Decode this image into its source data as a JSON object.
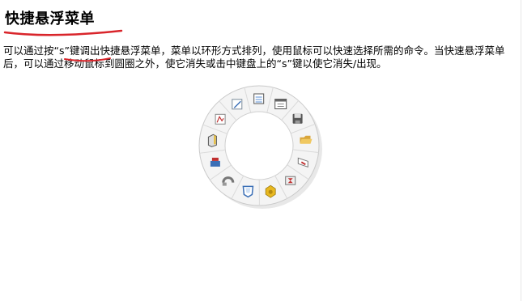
{
  "title": "快捷悬浮菜单",
  "description": "可以通过按“s”键调出快捷悬浮菜单，菜单以环形方式排列，使用鼠标可以快速选择所需的命令。当快速悬浮菜单后，可以通过移动鼠标到圆圈之外，使它消失或击中键盘上的“s”键以使它消失/出现。",
  "colors": {
    "title_underline": "#d9252b",
    "ring_face": "#f4f4f4",
    "ring_edge": "#c9c9c9",
    "ring_shadow": "#e2e2e2"
  },
  "ring_menu": {
    "icons": [
      "sketch-pencil-icon",
      "notebook-icon",
      "list-window-icon",
      "save-disk-icon",
      "open-folder-icon",
      "sheet-metal-icon",
      "measure-icon",
      "cube-icon",
      "shell-icon",
      "sweep-icon",
      "assembly-icon",
      "extrude-icon",
      "chart-icon"
    ]
  }
}
